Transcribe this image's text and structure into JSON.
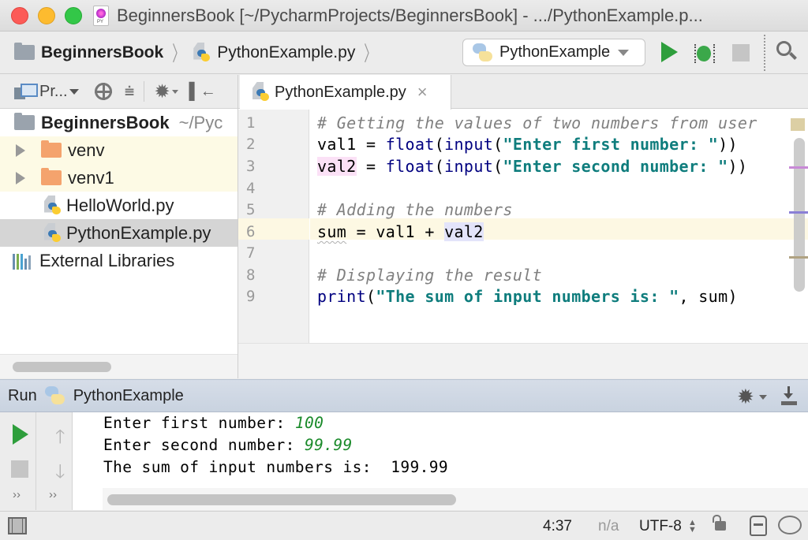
{
  "window": {
    "title": "BeginnersBook [~/PycharmProjects/BeginnersBook] - .../PythonExample.p..."
  },
  "navbar": {
    "breadcrumb": [
      "BeginnersBook",
      "PythonExample.py"
    ],
    "run_config": "PythonExample",
    "icons": [
      "run-icon",
      "debug-icon",
      "stop-icon",
      "search-icon"
    ]
  },
  "project": {
    "view_label": "Pr...",
    "root": {
      "name": "BeginnersBook",
      "path": "~/Pyc"
    },
    "items": [
      {
        "name": "venv",
        "type": "folder",
        "excluded": true
      },
      {
        "name": "venv1",
        "type": "folder",
        "excluded": true
      },
      {
        "name": "HelloWorld.py",
        "type": "python-file"
      },
      {
        "name": "PythonExample.py",
        "type": "python-file",
        "selected": true
      }
    ],
    "external": "External Libraries"
  },
  "editor": {
    "tab": "PythonExample.py",
    "current_line": 6,
    "lines": [
      {
        "num": "1",
        "code": "# Getting the values of two numbers from user"
      },
      {
        "num": "2",
        "code": "val1 = float(input(\"Enter first number: \"))"
      },
      {
        "num": "3",
        "code": "val2 = float(input(\"Enter second number: \"))"
      },
      {
        "num": "4",
        "code": ""
      },
      {
        "num": "5",
        "code": "# Adding the numbers"
      },
      {
        "num": "6",
        "code": "sum = val1 + val2"
      },
      {
        "num": "7",
        "code": ""
      },
      {
        "num": "8",
        "code": "# Displaying the result"
      },
      {
        "num": "9",
        "code": "print(\"The sum of input numbers is: \", sum)"
      }
    ],
    "tokens": {
      "l1": "# Getting the values of two numbers from user",
      "l2_var": "val1",
      "l2_eq": " = ",
      "l2_float": "float",
      "l2_p1": "(",
      "l2_input": "input",
      "l2_p2": "(",
      "l2_str": "\"Enter first number: \"",
      "l2_end": "))",
      "l3_var": "val2",
      "l3_eq": " = ",
      "l3_float": "float",
      "l3_p1": "(",
      "l3_input": "input",
      "l3_p2": "(",
      "l3_str": "\"Enter second number: \"",
      "l3_end": "))",
      "l5": "# Adding the numbers",
      "l6_sum": "sum",
      "l6_mid": " = val1 + ",
      "l6_val2": "val2",
      "l8": "# Displaying the result",
      "l9_print": "print",
      "l9_p": "(",
      "l9_str": "\"The sum of input numbers is: \"",
      "l9_rest": ", sum)"
    }
  },
  "run": {
    "label": "Run",
    "config": "PythonExample",
    "output": [
      {
        "prompt": "Enter first number: ",
        "input": "100"
      },
      {
        "prompt": "Enter second number: ",
        "input": "99.99"
      },
      {
        "prompt": "The sum of input numbers is:  199.99",
        "input": ""
      }
    ],
    "more": "››"
  },
  "status": {
    "position": "4:37",
    "line_sep": "n/a",
    "encoding": "UTF-8"
  },
  "colors": {
    "run_green": "#2e9e3c",
    "string_teal": "#0f7d7d",
    "comment_gray": "#808080",
    "console_input_green": "#1a8a2a"
  }
}
